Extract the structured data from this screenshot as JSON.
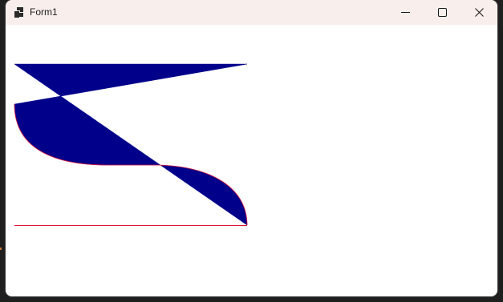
{
  "window": {
    "title": "Form1",
    "icons": {
      "app": "app-icon",
      "minimize": "minimize-icon",
      "maximize": "maximize-icon",
      "close": "close-icon"
    }
  },
  "colors": {
    "titlebar_bg": "#f8efec",
    "client_bg": "#ffffff",
    "shape_fill": "#00008b",
    "shape_outline": "#dc143c"
  }
}
